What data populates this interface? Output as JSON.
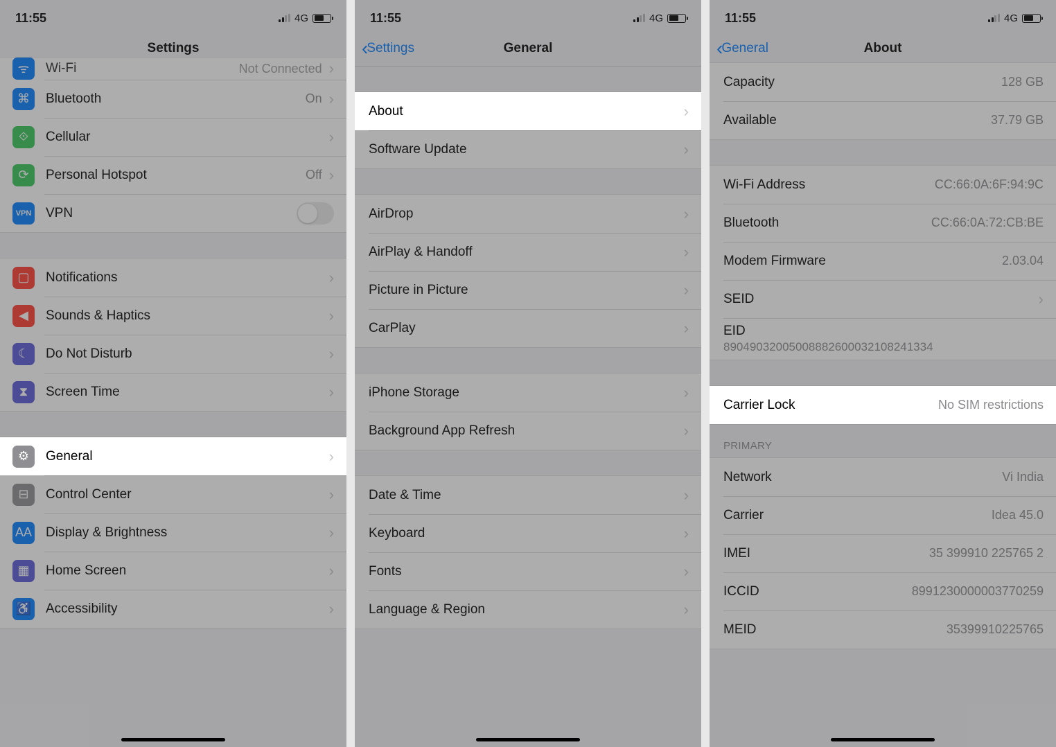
{
  "status": {
    "time": "11:55",
    "network": "4G"
  },
  "screen1": {
    "title": "Settings",
    "groups": [
      [
        {
          "key": "wifi",
          "label": "Wi-Fi",
          "value": "Not Connected",
          "icon_color": "ic-blue",
          "truncated": true
        },
        {
          "key": "bluetooth",
          "label": "Bluetooth",
          "value": "On",
          "icon_color": "ic-blue"
        },
        {
          "key": "cellular",
          "label": "Cellular",
          "value": "",
          "icon_color": "ic-green"
        },
        {
          "key": "hotspot",
          "label": "Personal Hotspot",
          "value": "Off",
          "icon_color": "ic-green"
        },
        {
          "key": "vpn",
          "label": "VPN",
          "toggle": true,
          "icon_color": "ic-blue"
        }
      ],
      [
        {
          "key": "notifications",
          "label": "Notifications",
          "icon_color": "ic-red"
        },
        {
          "key": "sounds",
          "label": "Sounds & Haptics",
          "icon_color": "ic-red"
        },
        {
          "key": "dnd",
          "label": "Do Not Disturb",
          "icon_color": "ic-indigo"
        },
        {
          "key": "screentime",
          "label": "Screen Time",
          "icon_color": "ic-indigo"
        }
      ],
      [
        {
          "key": "general",
          "label": "General",
          "icon_color": "ic-gray",
          "highlight": true
        },
        {
          "key": "control",
          "label": "Control Center",
          "icon_color": "ic-gray"
        },
        {
          "key": "display",
          "label": "Display & Brightness",
          "icon_color": "ic-blue"
        },
        {
          "key": "home",
          "label": "Home Screen",
          "icon_color": "ic-indigo"
        },
        {
          "key": "accessibility",
          "label": "Accessibility",
          "icon_color": "ic-blue"
        }
      ]
    ]
  },
  "screen2": {
    "back": "Settings",
    "title": "General",
    "groups": [
      [
        {
          "key": "about",
          "label": "About",
          "highlight": true
        },
        {
          "key": "software",
          "label": "Software Update"
        }
      ],
      [
        {
          "key": "airdrop",
          "label": "AirDrop"
        },
        {
          "key": "airplay",
          "label": "AirPlay & Handoff"
        },
        {
          "key": "pip",
          "label": "Picture in Picture"
        },
        {
          "key": "carplay",
          "label": "CarPlay"
        }
      ],
      [
        {
          "key": "storage",
          "label": "iPhone Storage"
        },
        {
          "key": "refresh",
          "label": "Background App Refresh"
        }
      ],
      [
        {
          "key": "datetime",
          "label": "Date & Time"
        },
        {
          "key": "keyboard",
          "label": "Keyboard"
        },
        {
          "key": "fonts",
          "label": "Fonts"
        },
        {
          "key": "language",
          "label": "Language & Region"
        }
      ]
    ]
  },
  "screen3": {
    "back": "General",
    "title": "About",
    "groups": [
      {
        "rows": [
          {
            "key": "capacity",
            "label": "Capacity",
            "value": "128 GB"
          },
          {
            "key": "available",
            "label": "Available",
            "value": "37.79 GB"
          }
        ]
      },
      {
        "rows": [
          {
            "key": "wifiaddr",
            "label": "Wi-Fi Address",
            "value": "CC:66:0A:6F:94:9C"
          },
          {
            "key": "btaddr",
            "label": "Bluetooth",
            "value": "CC:66:0A:72:CB:BE"
          },
          {
            "key": "modem",
            "label": "Modem Firmware",
            "value": "2.03.04"
          },
          {
            "key": "seid",
            "label": "SEID",
            "disclosure": true
          },
          {
            "key": "eid",
            "label": "EID",
            "sub": "89049032005008882600032108241334"
          }
        ]
      },
      {
        "rows": [
          {
            "key": "carrierlock",
            "label": "Carrier Lock",
            "value": "No SIM restrictions",
            "highlight": true
          }
        ]
      },
      {
        "header": "PRIMARY",
        "rows": [
          {
            "key": "network",
            "label": "Network",
            "value": "Vi India"
          },
          {
            "key": "carrier",
            "label": "Carrier",
            "value": "Idea 45.0"
          },
          {
            "key": "imei",
            "label": "IMEI",
            "value": "35 399910 225765 2"
          },
          {
            "key": "iccid",
            "label": "ICCID",
            "value": "8991230000003770259"
          },
          {
            "key": "meid",
            "label": "MEID",
            "value": "35399910225765"
          }
        ]
      }
    ]
  }
}
